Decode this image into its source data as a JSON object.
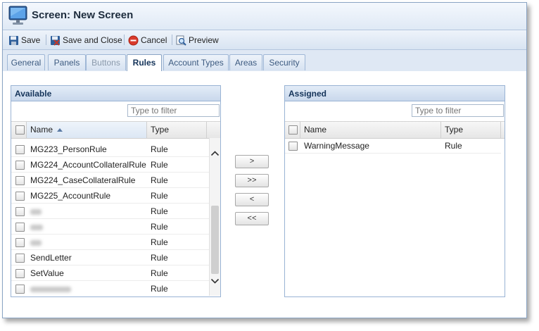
{
  "window": {
    "title": "Screen: New Screen"
  },
  "toolbar": {
    "save": "Save",
    "save_close": "Save and Close",
    "cancel": "Cancel",
    "preview": "Preview"
  },
  "tabs": [
    {
      "label": "General",
      "state": "normal"
    },
    {
      "label": "Panels",
      "state": "normal"
    },
    {
      "label": "Buttons",
      "state": "disabled"
    },
    {
      "label": "Rules",
      "state": "active"
    },
    {
      "label": "Account Types",
      "state": "normal"
    },
    {
      "label": "Areas",
      "state": "normal"
    },
    {
      "label": "Security",
      "state": "normal"
    }
  ],
  "available": {
    "title": "Available",
    "filter_placeholder": "Type to filter",
    "col_name": "Name",
    "col_type": "Type",
    "sort_indicator": "ascending",
    "rows": [
      {
        "name": "MG223_PersonRule",
        "type": "Rule"
      },
      {
        "name": "MG224_AccountCollateralRule",
        "type": "Rule"
      },
      {
        "name": "MG224_CaseCollateralRule",
        "type": "Rule"
      },
      {
        "name": "MG225_AccountRule",
        "type": "Rule"
      },
      {
        "name": "",
        "type": "Rule",
        "redacted": true
      },
      {
        "name": "",
        "type": "Rule",
        "redacted": true
      },
      {
        "name": "",
        "type": "Rule",
        "redacted": true
      },
      {
        "name": "SendLetter",
        "type": "Rule"
      },
      {
        "name": "SetValue",
        "type": "Rule"
      },
      {
        "name": "",
        "type": "Rule",
        "redacted": true
      }
    ]
  },
  "assigned": {
    "title": "Assigned",
    "filter_placeholder": "Type to filter",
    "col_name": "Name",
    "col_type": "Type",
    "rows": [
      {
        "name": "WarningMessage",
        "type": "Rule"
      }
    ]
  },
  "move_buttons": {
    "add": ">",
    "add_all": ">>",
    "remove": "<",
    "remove_all": "<<"
  },
  "colors": {
    "panel_border": "#99b3d4",
    "header_text": "#15345a",
    "tab_text": "#3c5a80",
    "cancel_icon": "#d93a2b"
  }
}
